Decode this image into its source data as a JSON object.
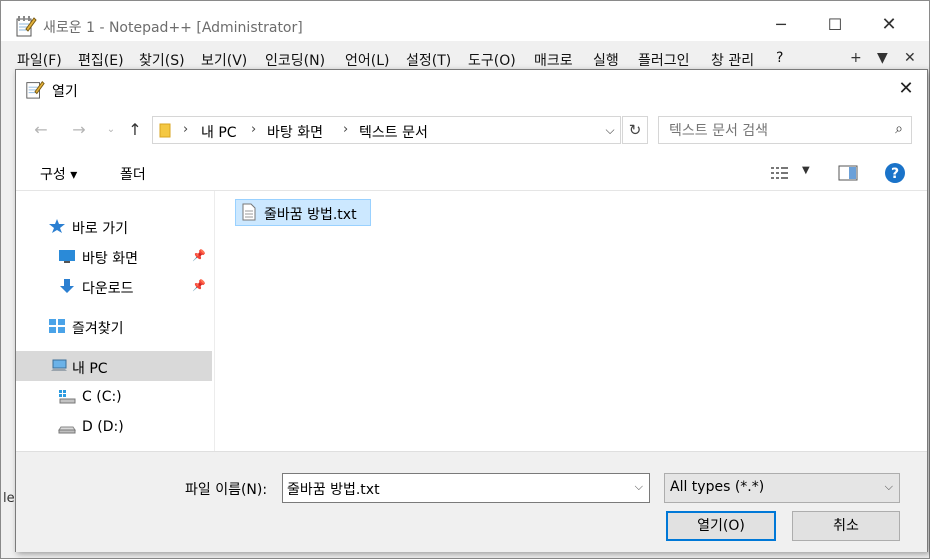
{
  "npp": {
    "title": "새로운 1 - Notepad++ [Administrator]",
    "menu": [
      "파일(F)",
      "편집(E)",
      "찾기(S)",
      "보기(V)",
      "인코딩(N)",
      "언어(L)",
      "설정(T)",
      "도구(O)",
      "매크로",
      "실행",
      "플러그인",
      "창 관리",
      "?"
    ],
    "menu_right": [
      "+",
      "▼",
      "✕"
    ],
    "side_char": "le"
  },
  "dialog": {
    "title": "열기",
    "address": [
      "내 PC",
      "바탕 화면",
      "텍스트 문서"
    ],
    "search_placeholder": "텍스트 문서 검색",
    "toolbar": {
      "organize": "구성 ▾",
      "new_folder": "폴더"
    },
    "nav": {
      "quick_access": "바로 가기",
      "desktop": "바탕 화면",
      "downloads": "다운로드",
      "favorites": "즐겨찾기",
      "this_pc": "내 PC",
      "drive_c": "C (C:)",
      "drive_d": "D (D:)"
    },
    "file": "줄바꿈 방법.txt",
    "filename_label": "파일 이름(N):",
    "filename_value": "줄바꿈 방법.txt",
    "file_type": "All types (*.*)",
    "open_button": "열기(O)",
    "cancel_button": "취소"
  }
}
